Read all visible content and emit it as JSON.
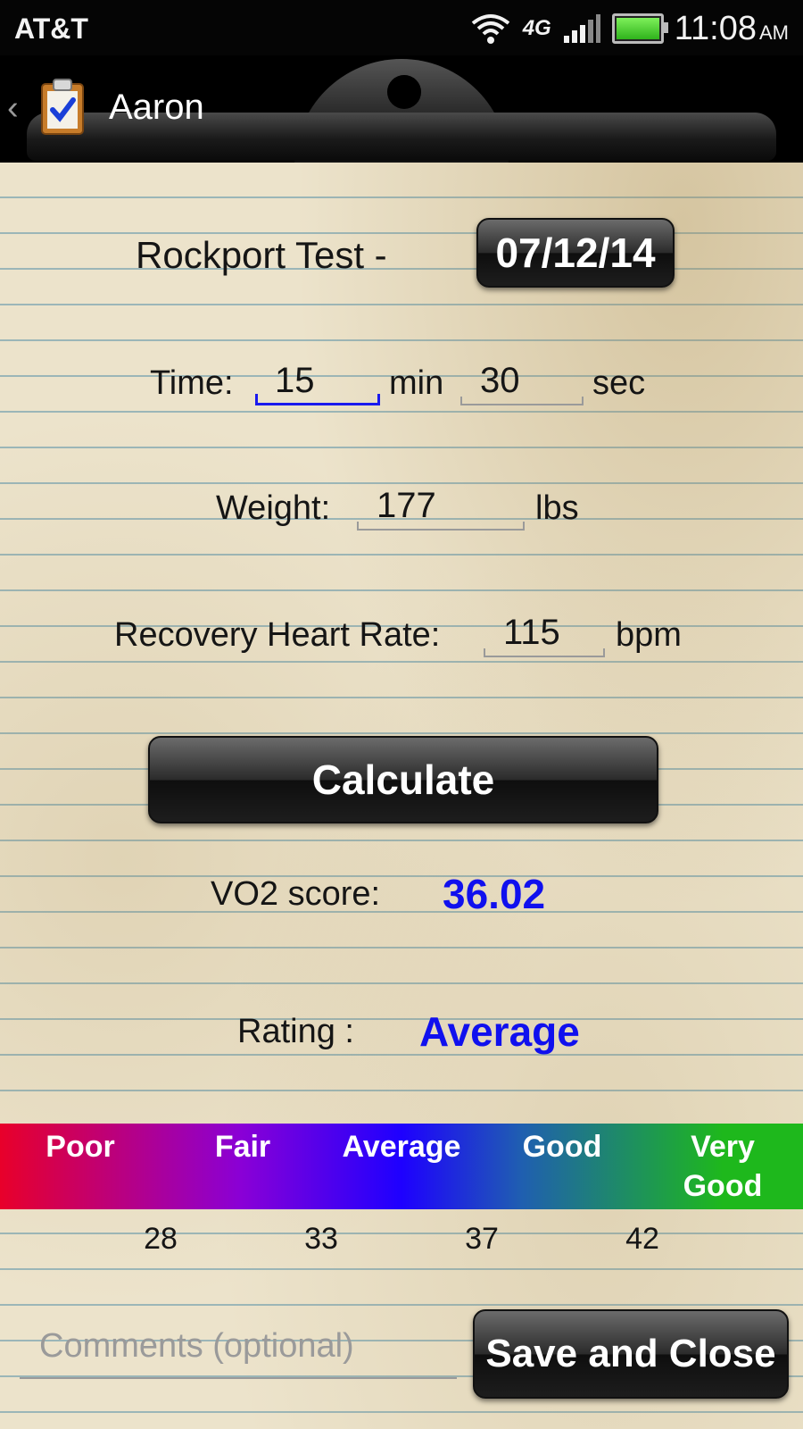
{
  "status_bar": {
    "carrier": "AT&T",
    "network": "4G",
    "time": "11:08",
    "ampm": "AM",
    "battery_level": 1.0
  },
  "header": {
    "title": "Aaron"
  },
  "test": {
    "name": "Rockport Test -",
    "date": "07/12/14"
  },
  "time_row": {
    "label": "Time:",
    "minutes": "15",
    "min_unit": "min",
    "seconds": "30",
    "sec_unit": "sec"
  },
  "weight_row": {
    "label": "Weight:",
    "value": "177",
    "unit": "lbs"
  },
  "hr_row": {
    "label": "Recovery Heart Rate:",
    "value": "115",
    "unit": "bpm"
  },
  "calculate_label": "Calculate",
  "vo2": {
    "label": "VO2 score:",
    "value": "36.02"
  },
  "rating": {
    "label": "Rating :",
    "value": "Average"
  },
  "scale": {
    "categories": [
      "Poor",
      "Fair",
      "Average",
      "Good",
      "Very Good"
    ],
    "thresholds": [
      "28",
      "33",
      "37",
      "42"
    ]
  },
  "comments": {
    "placeholder": "Comments (optional)"
  },
  "save_label": "Save and Close",
  "colors": {
    "accent_blue": "#1010ee",
    "poor": "#e8002a",
    "very_good": "#1eb81c"
  }
}
